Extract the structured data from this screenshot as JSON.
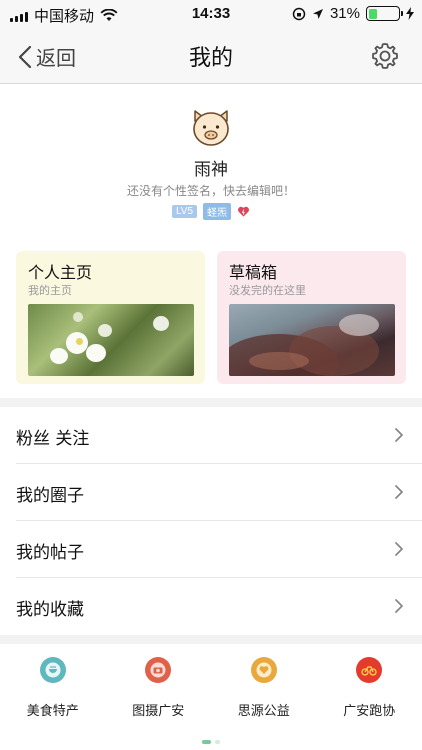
{
  "status_bar": {
    "carrier": "中国移动",
    "time": "14:33",
    "battery": "31%",
    "battery_level": 0.31
  },
  "nav": {
    "back_label": "返回",
    "title": "我的"
  },
  "profile": {
    "username": "雨神",
    "signature": "还没有个性签名，快去编辑吧！",
    "badges": [
      "LV5",
      "蛏炁"
    ]
  },
  "cards": [
    {
      "title": "个人主页",
      "subtitle": "我的主页"
    },
    {
      "title": "草稿箱",
      "subtitle": "没发完的在这里"
    }
  ],
  "menu": [
    {
      "label": "粉丝 关注"
    },
    {
      "label": "我的圈子"
    },
    {
      "label": "我的帖子"
    },
    {
      "label": "我的收藏"
    }
  ],
  "apps": [
    {
      "label": "美食特产",
      "icon": "food-specialty-icon",
      "color": "#5fb8bd"
    },
    {
      "label": "图摄广安",
      "icon": "photo-guangan-icon",
      "color": "#e0604a"
    },
    {
      "label": "思源公益",
      "icon": "siyuan-charity-icon",
      "color": "#e8a83c"
    },
    {
      "label": "广安跑协",
      "icon": "guangan-running-icon",
      "color": "#e53b2c"
    }
  ],
  "colors": {
    "active_dot": "#7ac89a",
    "card_yellow": "#fbf8e0",
    "card_pink": "#fbe9ee"
  }
}
